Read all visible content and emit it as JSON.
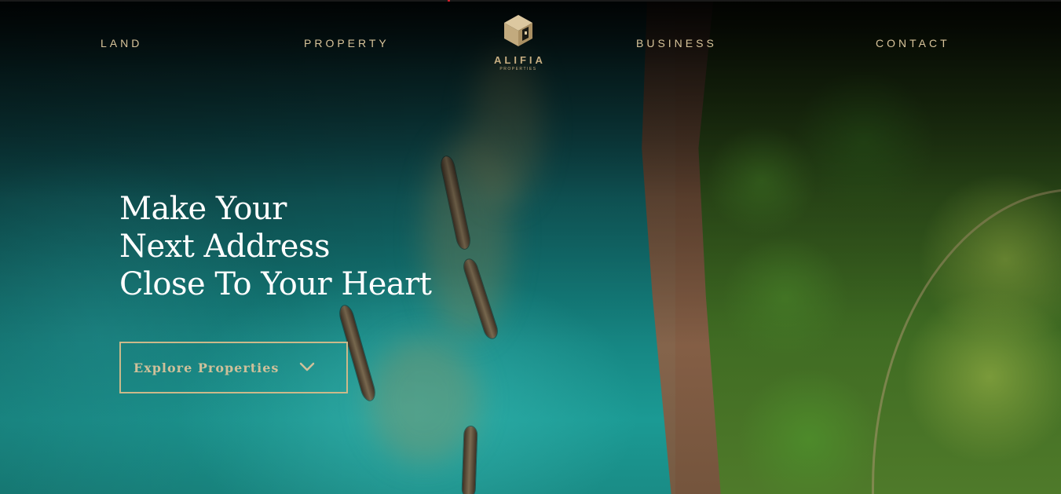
{
  "nav": {
    "items": [
      {
        "label": "LAND"
      },
      {
        "label": "PROPERTY"
      },
      {
        "label": "BUSINESS"
      },
      {
        "label": "CONTACT"
      }
    ]
  },
  "logo": {
    "name": "ALIFIA",
    "subtitle": "PROPERTIES",
    "icon": "house-cube-icon"
  },
  "hero": {
    "headline": [
      "Make Your",
      "Next Address",
      "Close To Your Heart"
    ],
    "cta_label": "Explore Properties",
    "cta_icon": "chevron-down-icon"
  },
  "colors": {
    "accent": "#d8c49a",
    "cta_border": "#cbb98a",
    "headline": "#ffffff"
  }
}
